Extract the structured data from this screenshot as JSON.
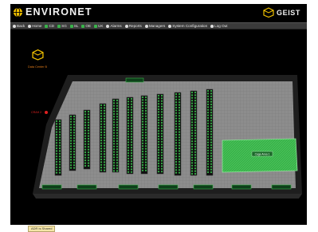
{
  "header": {
    "logo_text": "ENVIRONET",
    "brand_text": "GEIST"
  },
  "nav": {
    "items": [
      {
        "label": "Back",
        "icon": "back-arrow-icon"
      },
      {
        "label": "Home",
        "icon": "home-icon"
      },
      {
        "label": "CD",
        "icon": "floor-icon"
      },
      {
        "label": "SG",
        "icon": "floor-icon"
      },
      {
        "label": "SL",
        "icon": "floor-icon"
      },
      {
        "label": "OE",
        "icon": "floor-icon"
      },
      {
        "label": "UK",
        "icon": "floor-icon"
      },
      {
        "label": "Alarms",
        "icon": "bell-icon"
      },
      {
        "label": "Reports",
        "icon": "chart-icon"
      },
      {
        "label": "Managers",
        "icon": "grid-icon"
      },
      {
        "label": "System Configuration",
        "icon": "wrench-icon"
      },
      {
        "label": "Log Out",
        "icon": "logout-icon"
      }
    ]
  },
  "site_control": {
    "label": "Data Center B"
  },
  "alert_label": "CRAH 2",
  "zone_label": "Cage Area 1",
  "status_bar": {
    "text": "ADR is Shared"
  },
  "colors": {
    "accent": "#39b34a",
    "brand": "#f0c000",
    "background": "#000000",
    "alarm": "#e02020"
  }
}
